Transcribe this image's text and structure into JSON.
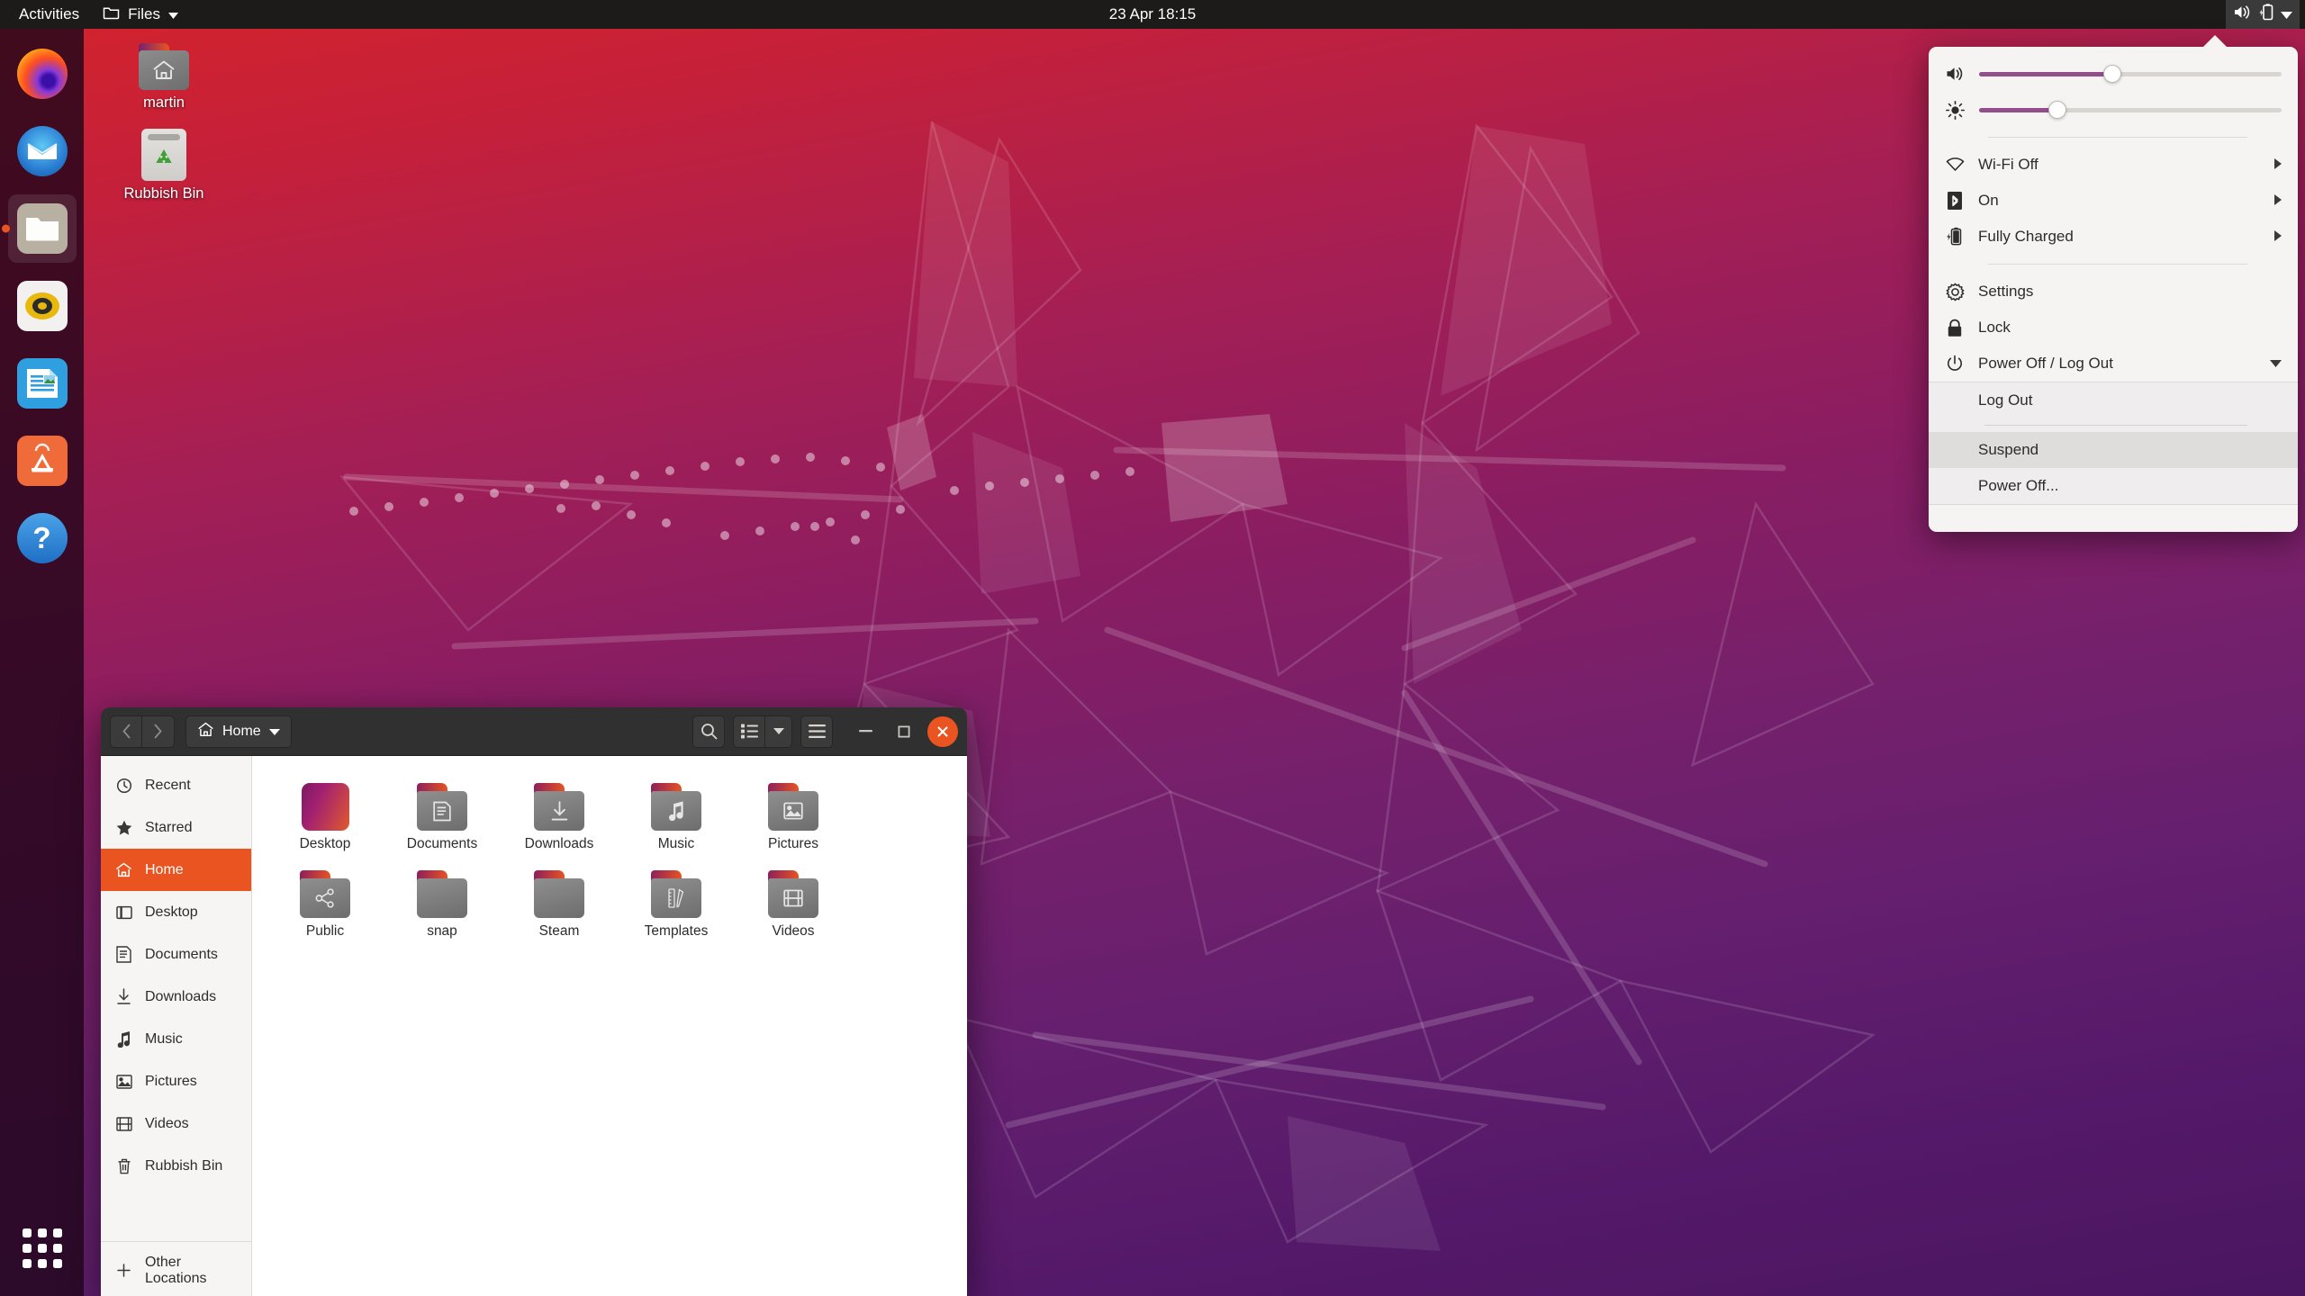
{
  "topbar": {
    "activities": "Activities",
    "app_menu": {
      "label": "Files",
      "icon": "folder-icon",
      "chevron": "chevron-down-icon"
    },
    "clock": "23 Apr  18:15",
    "status_icons": [
      "volume-icon",
      "battery-charging-icon",
      "chevron-down-icon"
    ]
  },
  "dock": {
    "items": [
      {
        "name": "firefox",
        "label": "Firefox",
        "running": false
      },
      {
        "name": "thunderbird",
        "label": "Thunderbird Mail",
        "running": false
      },
      {
        "name": "files",
        "label": "Files",
        "running": true
      },
      {
        "name": "rhythmbox",
        "label": "Rhythmbox",
        "running": false
      },
      {
        "name": "libreoffice-impress",
        "label": "LibreOffice Impress",
        "running": false
      },
      {
        "name": "ubuntu-software",
        "label": "Ubuntu Software",
        "running": false
      },
      {
        "name": "help",
        "label": "Help",
        "running": false
      }
    ],
    "show_apps": "Show Applications"
  },
  "desktop_icons": [
    {
      "label": "martin",
      "icon": "home-folder-icon"
    },
    {
      "label": "Rubbish Bin",
      "icon": "trash-icon"
    }
  ],
  "files_window": {
    "header": {
      "back": "Back",
      "forward": "Forward",
      "path_label": "Home",
      "path_icon": "home-icon",
      "path_chevron": "chevron-down-icon",
      "search": "search-icon",
      "view_list": "list-view-icon",
      "view_chevron": "chevron-down-icon",
      "menu": "hamburger-menu-icon",
      "minimize": "minimize-icon",
      "maximize": "maximize-icon",
      "close": "close-icon"
    },
    "sidebar": [
      {
        "label": "Recent",
        "icon": "clock-icon",
        "active": false
      },
      {
        "label": "Starred",
        "icon": "star-icon",
        "active": false
      },
      {
        "label": "Home",
        "icon": "home-icon",
        "active": true
      },
      {
        "label": "Desktop",
        "icon": "desktop-icon",
        "active": false
      },
      {
        "label": "Documents",
        "icon": "document-icon",
        "active": false
      },
      {
        "label": "Downloads",
        "icon": "download-icon",
        "active": false
      },
      {
        "label": "Music",
        "icon": "music-note-icon",
        "active": false
      },
      {
        "label": "Pictures",
        "icon": "image-icon",
        "active": false
      },
      {
        "label": "Videos",
        "icon": "film-icon",
        "active": false
      },
      {
        "label": "Rubbish Bin",
        "icon": "trash-icon",
        "active": false
      }
    ],
    "sidebar_other": {
      "label": "Other Locations",
      "icon": "plus-icon"
    },
    "files": [
      {
        "label": "Desktop",
        "glyph": "special"
      },
      {
        "label": "Documents",
        "glyph": "document"
      },
      {
        "label": "Downloads",
        "glyph": "download"
      },
      {
        "label": "Music",
        "glyph": "music"
      },
      {
        "label": "Pictures",
        "glyph": "image"
      },
      {
        "label": "Public",
        "glyph": "share"
      },
      {
        "label": "snap",
        "glyph": "none"
      },
      {
        "label": "Steam",
        "glyph": "none"
      },
      {
        "label": "Templates",
        "glyph": "templates"
      },
      {
        "label": "Videos",
        "glyph": "film"
      }
    ]
  },
  "system_menu": {
    "volume": {
      "icon": "volume-icon",
      "value": 44
    },
    "brightness": {
      "icon": "brightness-icon",
      "value": 26
    },
    "rows": [
      {
        "label": "Wi-Fi Off",
        "icon": "wifi-icon",
        "has_arrow": true
      },
      {
        "label": "On",
        "icon": "bluetooth-icon",
        "has_arrow": true
      },
      {
        "label": "Fully Charged",
        "icon": "battery-icon",
        "has_arrow": true
      }
    ],
    "rows2": [
      {
        "label": "Settings",
        "icon": "gear-icon",
        "has_arrow": false
      },
      {
        "label": "Lock",
        "icon": "lock-icon",
        "has_arrow": false
      },
      {
        "label": "Power Off / Log Out",
        "icon": "power-icon",
        "has_arrow": false,
        "expanded": true
      }
    ],
    "submenu": [
      {
        "label": "Log Out",
        "highlighted": false
      },
      {
        "label": "Suspend",
        "highlighted": true
      },
      {
        "label": "Power Off...",
        "highlighted": false
      }
    ]
  },
  "colors": {
    "ubuntu_orange": "#e95420",
    "ubuntu_aubergine": "#2c001e",
    "topbar": "#1d1b19",
    "slider_purple": "#924d8b"
  }
}
